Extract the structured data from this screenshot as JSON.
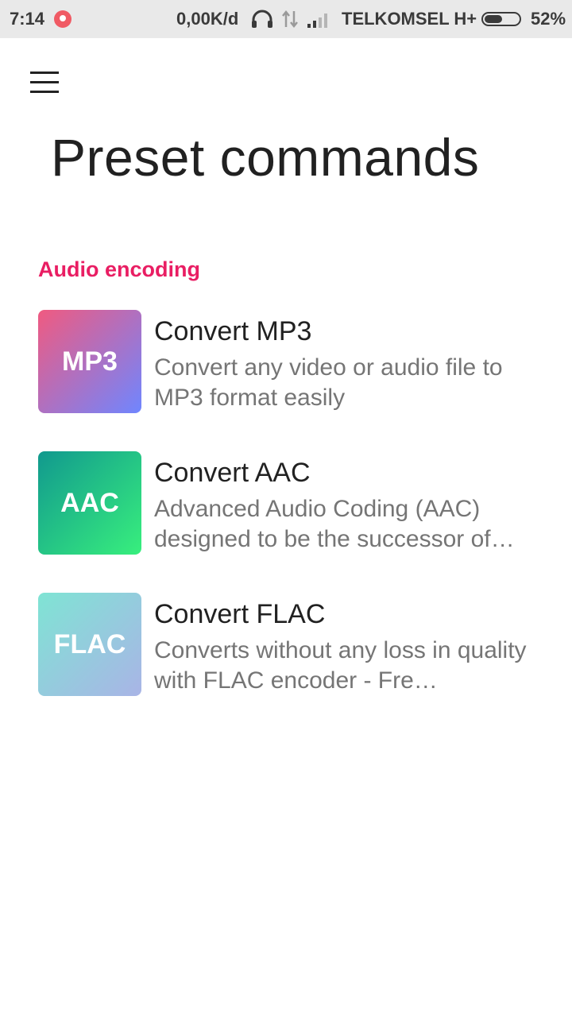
{
  "status_bar": {
    "time": "7:14",
    "speed": "0,00K/d",
    "carrier": "TELKOMSEL H+",
    "battery": "52%",
    "battery_level": 0.52
  },
  "header": {
    "menu_icon": "hamburger-menu-icon",
    "title": "Preset commands"
  },
  "section": {
    "label": "Audio encoding",
    "accent_color": "#e91e63"
  },
  "items": [
    {
      "badge": "MP3",
      "title": "Convert MP3",
      "description": "Convert any video or audio file to MP3 format easily",
      "gradient": [
        "#f05a80",
        "#6f86ff"
      ]
    },
    {
      "badge": "AAC",
      "title": "Convert AAC",
      "description": "Advanced Audio Coding (AAC) designed to be the successor of…",
      "gradient": [
        "#11998e",
        "#38ef7d"
      ]
    },
    {
      "badge": "FLAC",
      "title": "Convert FLAC",
      "description": "Converts without any loss in quality with FLAC encoder - Fre…",
      "gradient": [
        "#7fe4d4",
        "#a9b4e6"
      ]
    }
  ]
}
